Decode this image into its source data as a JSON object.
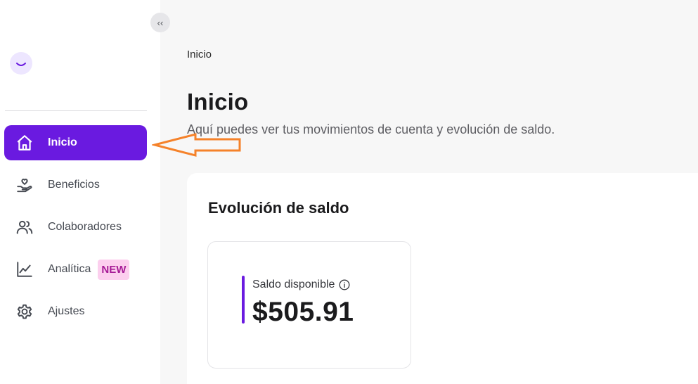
{
  "sidebar": {
    "collapse_label": "‹‹",
    "logo_icon": "smile-icon",
    "items": [
      {
        "label": "Inicio",
        "icon": "home-icon",
        "active": true
      },
      {
        "label": "Beneficios",
        "icon": "hand-heart-icon",
        "active": false
      },
      {
        "label": "Colaboradores",
        "icon": "users-icon",
        "active": false
      },
      {
        "label": "Analítica",
        "icon": "chart-line-icon",
        "active": false,
        "badge": "NEW"
      },
      {
        "label": "Ajustes",
        "icon": "gear-icon",
        "active": false
      }
    ]
  },
  "header": {
    "breadcrumb": "Inicio",
    "title": "Inicio",
    "subtitle": "Aquí puedes ver tus movimientos de cuenta y evolución de saldo."
  },
  "balance_section": {
    "title": "Evolución de saldo",
    "card": {
      "label": "Saldo disponible",
      "amount": "$505.91"
    }
  },
  "colors": {
    "accent": "#6a1ae0",
    "annotation_arrow": "#f5822a",
    "badge_bg": "#fccfee",
    "badge_text": "#a61b96"
  }
}
